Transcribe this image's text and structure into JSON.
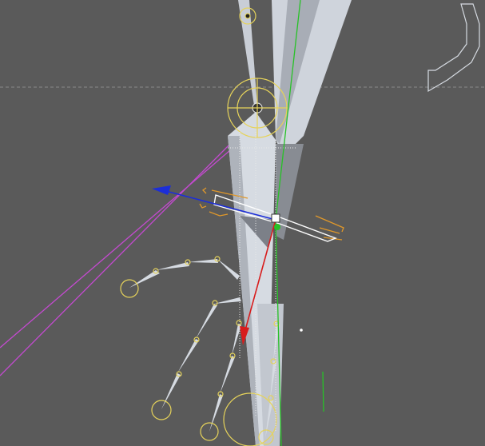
{
  "viewport": {
    "name": "3D viewport",
    "background": "#5a5a5a",
    "grid_line_color": "#8a8a8a",
    "bone_color": "#d6dbe2",
    "bone_shadow_color": "#8d9199",
    "selection_color": "#e6d35a",
    "constraint_color": "#e0982a",
    "guide_color": "#c44ad0",
    "axes": {
      "x_axis_color": "#d81c1c",
      "y_axis_color": "#27c227",
      "z_axis_color": "#1c2ed8"
    },
    "icons": [
      "move-gizmo-icon",
      "pivot-handle-icon"
    ]
  }
}
